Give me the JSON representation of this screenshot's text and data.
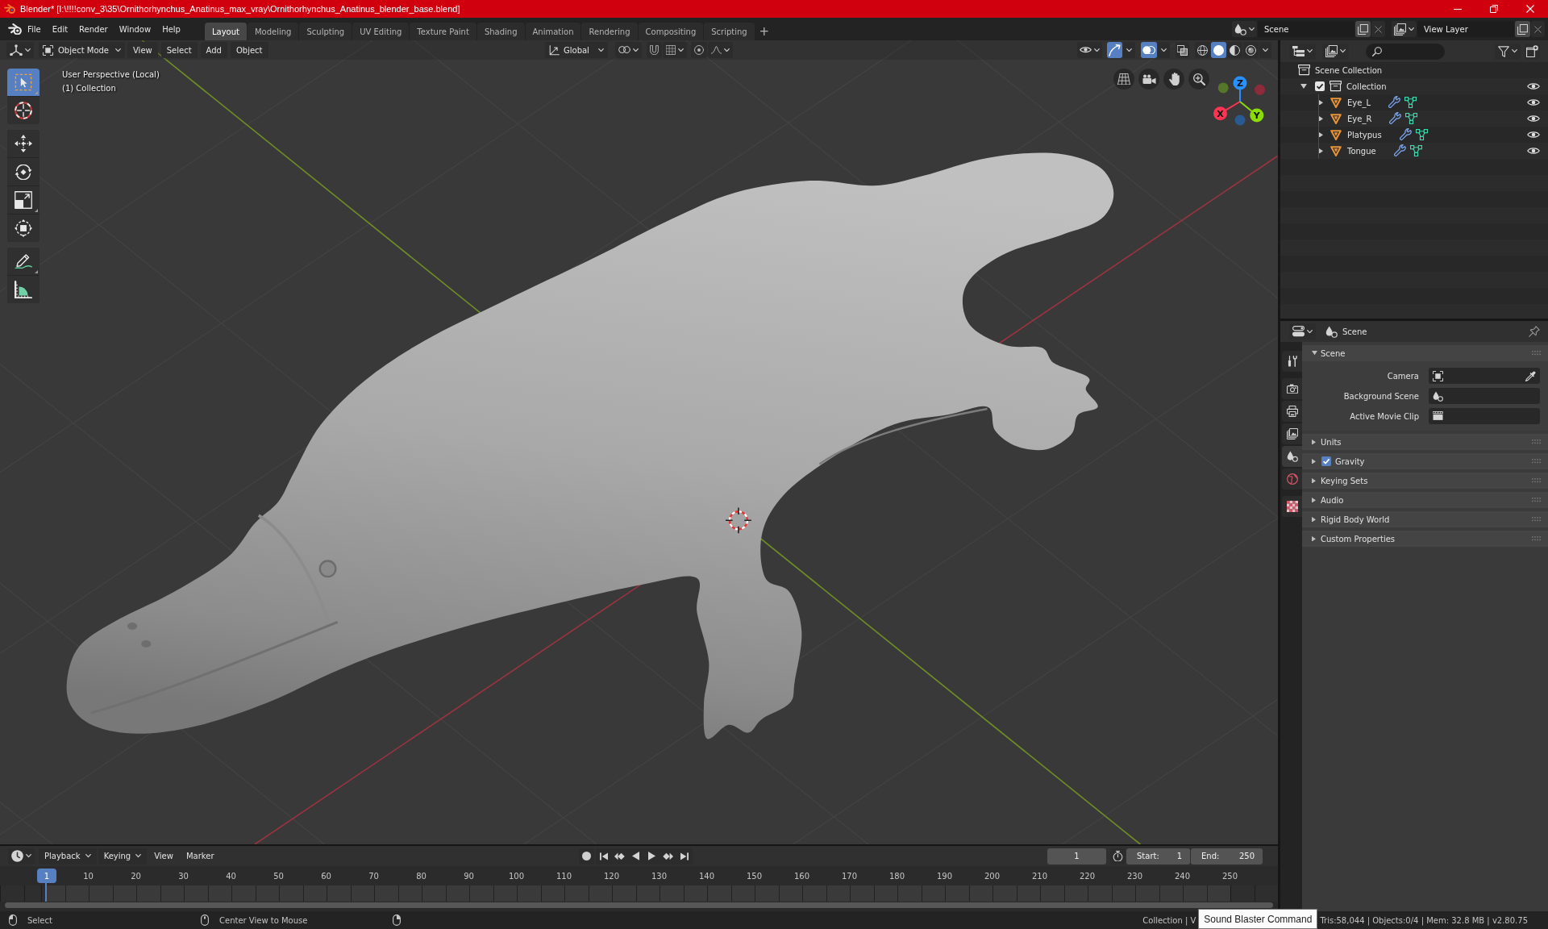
{
  "window": {
    "title": "Blender* [I:\\!!!!conv_3\\35\\Ornithorhynchus_Anatinus_max_vray\\Ornithorhynchus_Anatinus_blender_base.blend]"
  },
  "menu": [
    "File",
    "Edit",
    "Render",
    "Window",
    "Help"
  ],
  "workspaces": [
    {
      "label": "Layout",
      "selected": true
    },
    {
      "label": "Modeling",
      "selected": false
    },
    {
      "label": "Sculpting",
      "selected": false
    },
    {
      "label": "UV Editing",
      "selected": false
    },
    {
      "label": "Texture Paint",
      "selected": false
    },
    {
      "label": "Shading",
      "selected": false
    },
    {
      "label": "Animation",
      "selected": false
    },
    {
      "label": "Rendering",
      "selected": false
    },
    {
      "label": "Compositing",
      "selected": false
    },
    {
      "label": "Scripting",
      "selected": false
    }
  ],
  "add_workspace": "+",
  "scene_selector": {
    "value": "Scene"
  },
  "view_layer_selector": {
    "value": "View Layer"
  },
  "viewport": {
    "mode": "Object Mode",
    "menus": [
      "View",
      "Select",
      "Add",
      "Object"
    ],
    "orientation": "Global",
    "toggles": [
      {
        "kind": "gizmos",
        "on": true
      },
      {
        "kind": "overlays",
        "on": true
      },
      {
        "kind": "xray",
        "on": false
      }
    ],
    "shading": [
      {
        "kind": "wireframe",
        "selected": false
      },
      {
        "kind": "solid",
        "selected": true
      },
      {
        "kind": "material",
        "selected": false
      },
      {
        "kind": "rendered",
        "selected": false
      }
    ],
    "tool_groups": [
      [
        {
          "kind": "select",
          "selected": true
        },
        {
          "kind": "cursor",
          "selected": false
        }
      ],
      [
        {
          "kind": "move",
          "selected": false
        },
        {
          "kind": "rotate",
          "selected": false
        },
        {
          "kind": "scale",
          "selected": false
        },
        {
          "kind": "transform",
          "selected": false
        }
      ],
      [
        {
          "kind": "annotate",
          "selected": false
        },
        {
          "kind": "measure",
          "selected": false
        }
      ]
    ],
    "info": [
      "User Perspective (Local)",
      "(1) Collection"
    ],
    "axes": [
      {
        "kind": "x",
        "label": "X"
      },
      {
        "kind": "y",
        "label": "Y"
      },
      {
        "kind": "z",
        "label": "Z"
      }
    ]
  },
  "outliner": {
    "root": "Scene Collection",
    "items": [
      {
        "name": "Collection",
        "kind": "collection",
        "expanded": true,
        "checked": true,
        "visible": true,
        "children": [
          {
            "name": "Eye_L",
            "kind": "mesh",
            "expanded": false,
            "modifiers": true,
            "visible": true
          },
          {
            "name": "Eye_R",
            "kind": "mesh",
            "expanded": false,
            "modifiers": true,
            "visible": true
          },
          {
            "name": "Platypus",
            "kind": "mesh",
            "expanded": false,
            "modifiers": true,
            "visible": true
          },
          {
            "name": "Tongue",
            "kind": "mesh",
            "expanded": false,
            "modifiers": true,
            "visible": true
          }
        ]
      }
    ]
  },
  "properties": {
    "context": "Scene",
    "tabs": [
      [
        {
          "kind": "tool",
          "selected": false
        }
      ],
      [
        {
          "kind": "render",
          "selected": false
        },
        {
          "kind": "output",
          "selected": false
        },
        {
          "kind": "view_layer",
          "selected": false
        },
        {
          "kind": "scene",
          "selected": true
        },
        {
          "kind": "world",
          "selected": false
        }
      ],
      [
        {
          "kind": "texture",
          "selected": false
        }
      ]
    ],
    "panels": [
      {
        "title": "Scene",
        "expanded": true,
        "fields": [
          {
            "label": "Camera",
            "kind": "camera"
          },
          {
            "label": "Background Scene",
            "kind": "scene"
          },
          {
            "label": "Active Movie Clip",
            "kind": "clip"
          }
        ]
      },
      {
        "title": "Units",
        "expanded": false
      },
      {
        "title": "Gravity",
        "expanded": false,
        "toggle": {
          "checked": true
        }
      },
      {
        "title": "Keying Sets",
        "expanded": false
      },
      {
        "title": "Audio",
        "expanded": false
      },
      {
        "title": "Rigid Body World",
        "expanded": false
      },
      {
        "title": "Custom Properties",
        "expanded": false
      }
    ]
  },
  "timeline": {
    "menus": [
      {
        "label": "Playback",
        "kind": "dropdown"
      },
      {
        "label": "Keying",
        "kind": "dropdown"
      },
      {
        "label": "View",
        "kind": "menu"
      },
      {
        "label": "Marker",
        "kind": "menu"
      }
    ],
    "auto_keying": false,
    "current_frame": "1",
    "start_label": "Start:",
    "start": "1",
    "end_label": "End:",
    "end": "250",
    "playhead": "1",
    "ruler": [
      "10",
      "20",
      "30",
      "40",
      "50",
      "60",
      "70",
      "80",
      "90",
      "100",
      "110",
      "120",
      "130",
      "140",
      "150",
      "160",
      "170",
      "180",
      "190",
      "200",
      "210",
      "220",
      "230",
      "240",
      "250"
    ]
  },
  "status_bar": {
    "hints": [
      {
        "kind": "left",
        "label": "Select"
      },
      {
        "kind": "middle",
        "label": "Center View to Mouse"
      },
      {
        "kind": "right"
      }
    ],
    "scene_info": "Collection | V",
    "stats": "Tris:58,044 | Objects:0/4 | Mem: 32.8 MB | v2.80.75"
  },
  "tooltip": "Sound Blaster Command"
}
